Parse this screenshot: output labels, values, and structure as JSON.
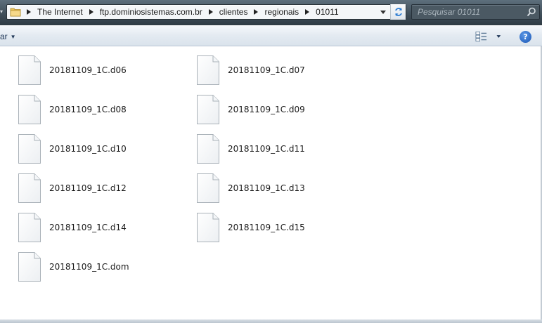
{
  "address_bar": {
    "breadcrumbs": [
      "The Internet",
      "ftp.dominiosistemas.com.br",
      "clientes",
      "regionais",
      "01011"
    ]
  },
  "search": {
    "placeholder": "Pesquisar 01011"
  },
  "command_bar": {
    "truncated_item_label": "ar"
  },
  "files": [
    {
      "name": "20181109_1C.d06"
    },
    {
      "name": "20181109_1C.d07"
    },
    {
      "name": "20181109_1C.d08"
    },
    {
      "name": "20181109_1C.d09"
    },
    {
      "name": "20181109_1C.d10"
    },
    {
      "name": "20181109_1C.d11"
    },
    {
      "name": "20181109_1C.d12"
    },
    {
      "name": "20181109_1C.d13"
    },
    {
      "name": "20181109_1C.d14"
    },
    {
      "name": "20181109_1C.d15"
    },
    {
      "name": "20181109_1C.dom"
    }
  ],
  "icons": {
    "folder": "folder-icon",
    "refresh": "refresh-icon",
    "search": "search-icon",
    "views": "change-view-icon",
    "help": "help-icon",
    "file": "generic-file-icon"
  }
}
